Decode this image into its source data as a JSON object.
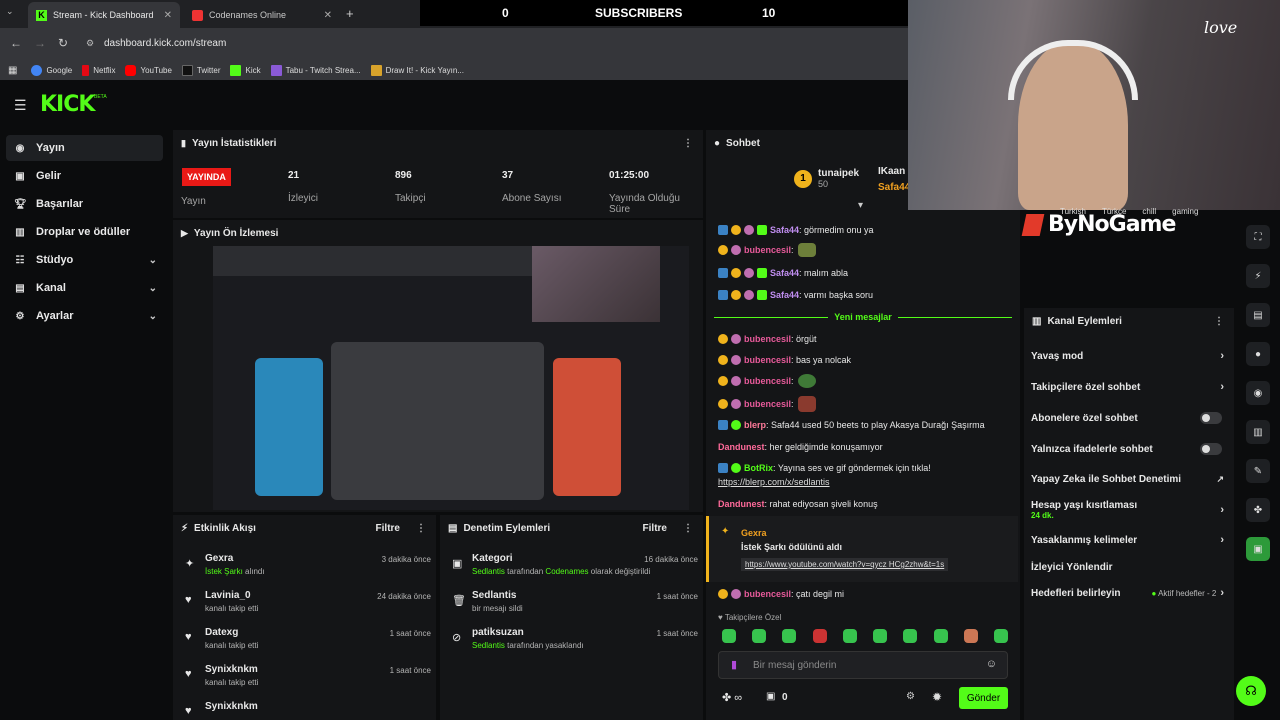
{
  "browser": {
    "tabs": [
      {
        "title": "Stream - Kick Dashboard"
      },
      {
        "title": "Codenames Online"
      }
    ],
    "url": "dashboard.kick.com/stream",
    "bookmarks": [
      "Google",
      "Netflix",
      "YouTube",
      "Twitter",
      "Kick",
      "Tabu - Twitch Strea...",
      "Draw It! - Kick Yayın..."
    ]
  },
  "overlay": {
    "left_count": "0",
    "label": "SUBSCRIBERS",
    "right_count": "10"
  },
  "logo": {
    "text": "KICK",
    "beta": "BETA"
  },
  "sidebar": {
    "items": [
      {
        "label": "Yayın"
      },
      {
        "label": "Gelir"
      },
      {
        "label": "Başarılar"
      },
      {
        "label": "Droplar ve ödüller"
      },
      {
        "label": "Stüdyo"
      },
      {
        "label": "Kanal"
      },
      {
        "label": "Ayarlar"
      }
    ]
  },
  "stats": {
    "title": "Yayın İstatistikleri",
    "live": "YAYINDA",
    "live_label": "Yayın",
    "viewers": "21",
    "viewers_label": "İzleyici",
    "followers": "896",
    "followers_label": "Takipçi",
    "subs": "37",
    "subs_label": "Abone Sayısı",
    "duration": "01:25:00",
    "duration_label": "Yayında Olduğu Süre"
  },
  "preview": {
    "title": "Yayın Ön İzlemesi"
  },
  "activity": {
    "title": "Etkinlik Akışı",
    "filter": "Filtre",
    "items": [
      {
        "name": "Gexra",
        "desc": "İstek Şarkı",
        "desc2": "alındı",
        "time": "3 dakika önce"
      },
      {
        "name": "Lavinia_0",
        "desc": "kanalı takip etti",
        "time": "24 dakika önce"
      },
      {
        "name": "Datexg",
        "desc": "kanalı takip etti",
        "time": "1 saat önce"
      },
      {
        "name": "Synixknkm",
        "desc": "kanalı takip etti",
        "time": "1 saat önce"
      },
      {
        "name": "Synixknkm",
        "desc": "",
        "time": ""
      }
    ]
  },
  "moderation": {
    "title": "Denetim Eylemleri",
    "filter": "Filtre",
    "items": [
      {
        "name": "Kategori",
        "who": "Sedlantis",
        "mid": "tarafından",
        "cat": "Codenames",
        "end": "olarak değiştirildi",
        "time": "16 dakika önce"
      },
      {
        "name": "Sedlantis",
        "desc": "bir mesajı sildi",
        "time": "1 saat önce"
      },
      {
        "name": "patiksuzan",
        "who": "Sedlantis",
        "end": "tarafından yasaklandı",
        "time": "1 saat önce"
      }
    ]
  },
  "chat": {
    "title": "Sohbet",
    "top_users": [
      {
        "name": "tunaipek",
        "count": "50"
      },
      {
        "name": "IKaan"
      },
      {
        "name": "Safa44"
      }
    ],
    "new_messages": "Yeni mesajlar",
    "messages": [
      {
        "user": "Safa44",
        "text": ": görmedim onu ya"
      },
      {
        "user": "bubencesil",
        "text": ":"
      },
      {
        "user": "Safa44",
        "text": ": malım abla"
      },
      {
        "user": "Safa44",
        "text": ": varmı başka soru"
      },
      {
        "user": "bubencesil",
        "text": ": örgüt"
      },
      {
        "user": "bubencesil",
        "text": ": bas ya nolcak"
      },
      {
        "user": "bubencesil",
        "text": ":"
      },
      {
        "user": "bubencesil",
        "text": ":"
      },
      {
        "user": "blerp",
        "text": ": Safa44 used 50 beets to play Akasya Durağı Şaşırma"
      },
      {
        "user": "Dandunest",
        "text": ": her geldiğimde konuşamıyor"
      },
      {
        "user": "BotRix",
        "text": ": Yayına ses ve gif göndermek için tıkla!",
        "link": "https://blerp.com/x/sedlantis"
      },
      {
        "user": "Dandunest",
        "text": ": rahat ediyosan şiveli konuş"
      },
      {
        "user": "bubencesil",
        "text": ": çatı degil mi"
      }
    ],
    "reward": {
      "user": "Gexra",
      "text": "İstek Şarkı ödülünü aldı",
      "link": "https://www.youtube.com/watch?v=qycz HCg2zhw&t=1s"
    },
    "followers_only": "Takipçilere Özel",
    "input_placeholder": "Bir mesaj gönderin",
    "points": "0",
    "send": "Gönder"
  },
  "stream_tags": [
    "Turkish",
    "Türkçe",
    "chill",
    "gaming"
  ],
  "brand": "ByNoGame",
  "channel_actions": {
    "title": "Kanal Eylemleri",
    "items": [
      {
        "label": "Yavaş mod"
      },
      {
        "label": "Takipçilere özel sohbet"
      },
      {
        "label": "Abonelere özel sohbet"
      },
      {
        "label": "Yalnızca ifadelerle sohbet"
      },
      {
        "label": "Yapay Zeka ile Sohbet Denetimi"
      },
      {
        "label": "Hesap yaşı kısıtlaması",
        "sub": "24 dk."
      },
      {
        "label": "Yasaklanmış kelimeler"
      },
      {
        "label": "İzleyici Yönlendir"
      },
      {
        "label": "Hedefleri belirleyin",
        "extra": "Aktif hedefler - 2"
      }
    ]
  },
  "colors": {
    "accent": "#53fc18",
    "live": "#e91916",
    "panel": "#141517"
  }
}
